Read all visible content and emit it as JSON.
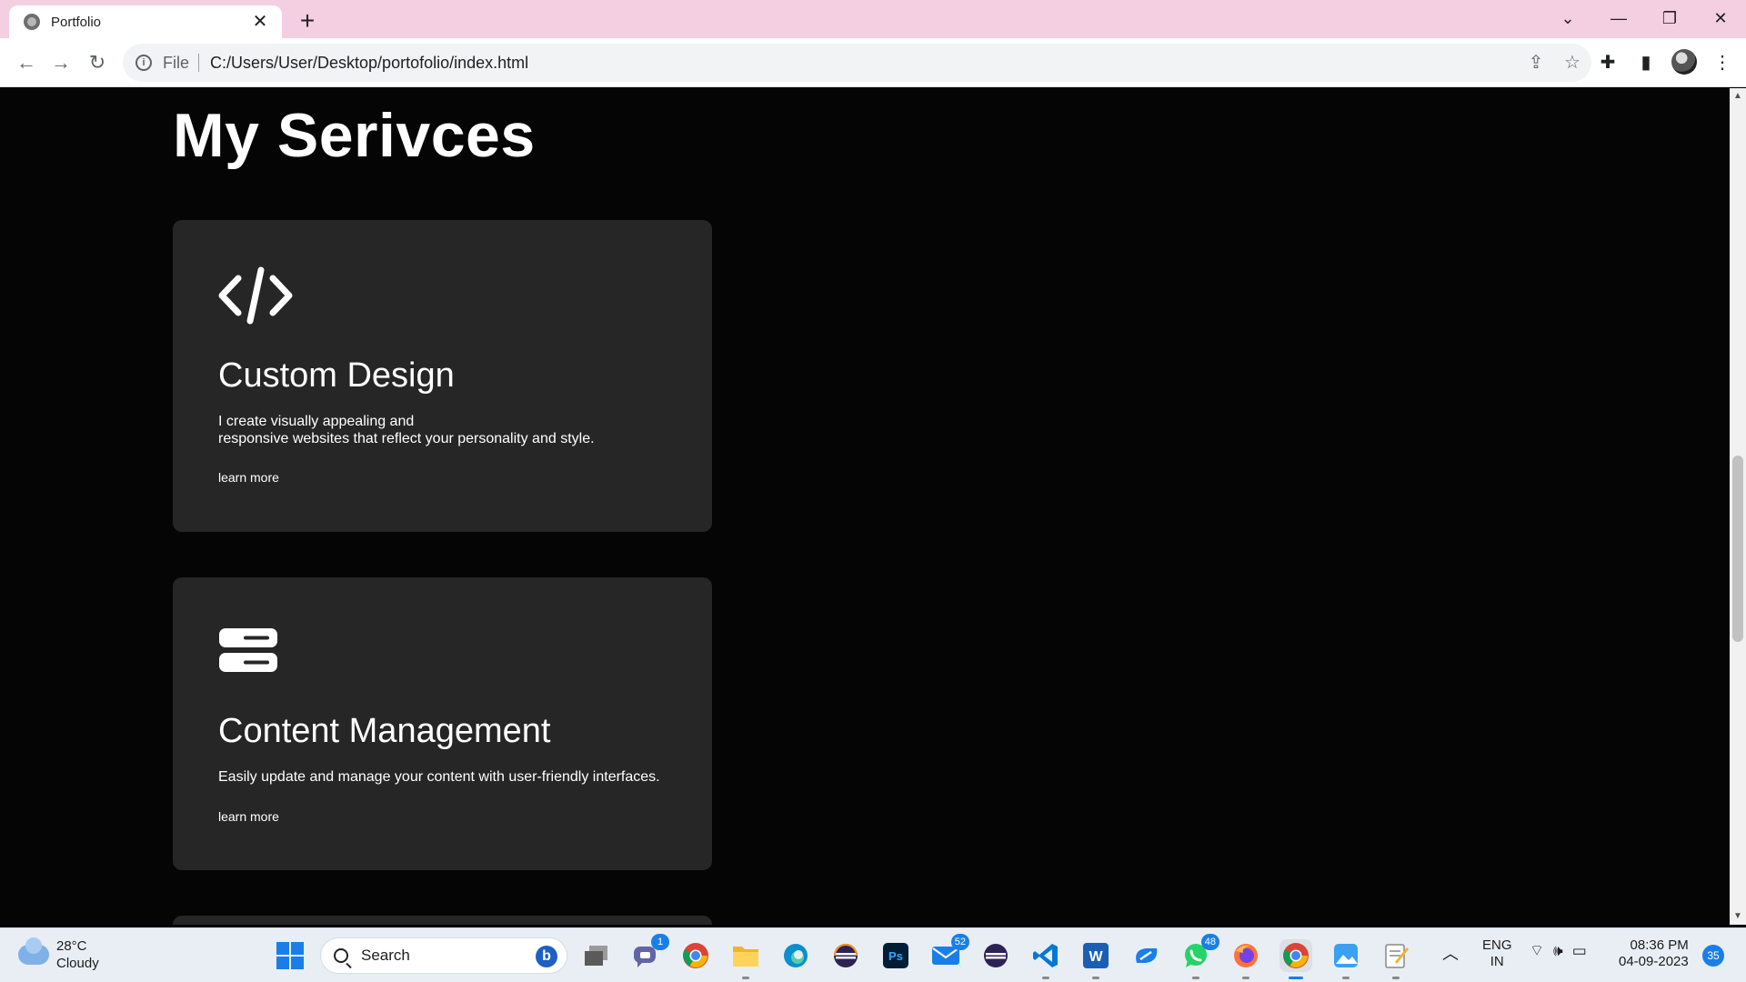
{
  "browser": {
    "tab_title": "Portfolio",
    "url_scheme": "File",
    "url": "C:/Users/User/Desktop/portofolio/index.html"
  },
  "page": {
    "section_title": "My Serivces",
    "cards": [
      {
        "icon": "code-icon",
        "title": "Custom Design",
        "text_line1": "I create visually appealing and",
        "text_line2": "responsive websites that reflect your personality and style.",
        "link": "learn more"
      },
      {
        "icon": "server-icon",
        "title": "Content Management",
        "text_line1": "Easily update and manage your content with user-friendly interfaces.",
        "link": "learn more"
      }
    ]
  },
  "taskbar": {
    "weather_temp": "28°C",
    "weather_desc": "Cloudy",
    "search_label": "Search",
    "badges": {
      "teams": "1",
      "mail": "52",
      "whatsapp": "48"
    },
    "lang_line1": "ENG",
    "lang_line2": "IN",
    "time": "08:36 PM",
    "date": "04-09-2023",
    "notification_count": "35"
  },
  "colors": {
    "tabstrip_bg": "#f4cfe1",
    "page_bg": "#050505",
    "card_bg": "#262626",
    "text": "#ffffff",
    "accent": "#1a7ee8"
  }
}
